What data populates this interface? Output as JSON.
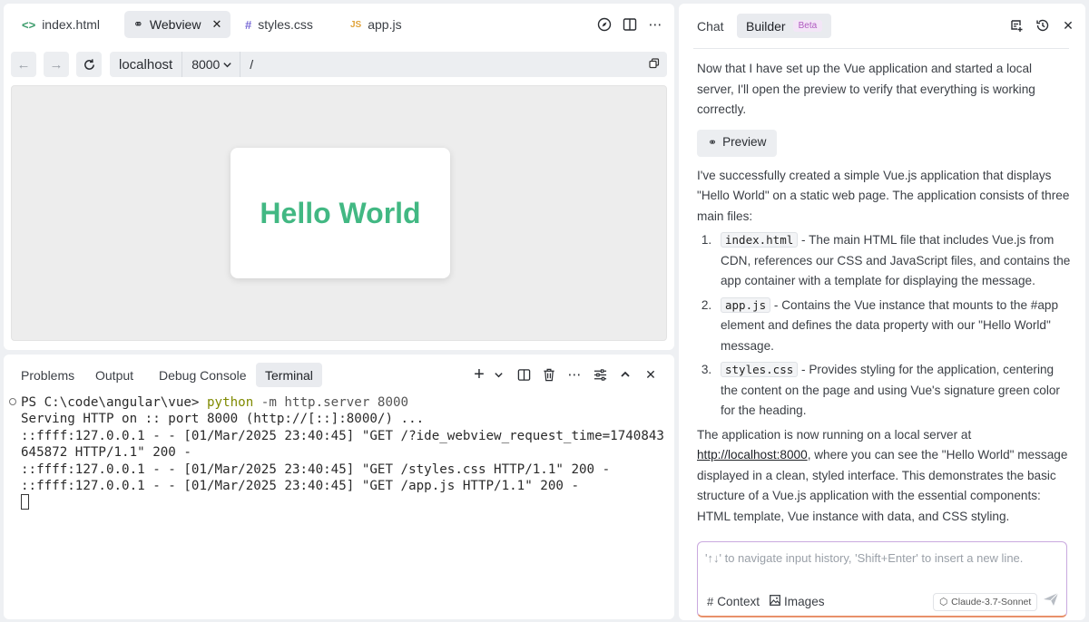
{
  "editor": {
    "tabs": [
      {
        "icon": "<>",
        "label": "index.html"
      },
      {
        "icon": "⚭",
        "label": "Webview",
        "close": "✕"
      },
      {
        "icon": "#",
        "label": "styles.css"
      },
      {
        "icon": "JS",
        "label": "app.js"
      }
    ],
    "toolbar_icons": [
      "compass-icon",
      "split-editor-icon",
      "more-icon"
    ]
  },
  "nav": {
    "host": "localhost",
    "port": "8000",
    "path": "/"
  },
  "webview": {
    "heading": "Hello World",
    "heading_color": "#42b883"
  },
  "panel": {
    "tabs": [
      "Problems",
      "Output",
      "Debug Console",
      "Terminal"
    ],
    "active_tab": "Terminal"
  },
  "terminal": {
    "prompt": "PS C:\\code\\angular\\vue> ",
    "command": "python",
    "args": " -m http.server 8000",
    "lines": [
      "Serving HTTP on :: port 8000 (http://[::]:8000/) ...",
      "::ffff:127.0.0.1 - - [01/Mar/2025 23:40:45] \"GET /?ide_webview_request_time=1740843",
      "645872 HTTP/1.1\" 200 -",
      "::ffff:127.0.0.1 - - [01/Mar/2025 23:40:45] \"GET /styles.css HTTP/1.1\" 200 -",
      "::ffff:127.0.0.1 - - [01/Mar/2025 23:40:45] \"GET /app.js HTTP/1.1\" 200 -"
    ]
  },
  "chat": {
    "tabs": {
      "chat": "Chat",
      "builder": "Builder",
      "badge": "Beta"
    },
    "intro": "Now that I have set up the Vue application and started a local server, I'll open the preview to verify that everything is working correctly.",
    "preview_label": "Preview",
    "summary": "I've successfully created a simple Vue.js application that displays \"Hello World\" on a static web page. The application consists of three main files:",
    "files": [
      {
        "name": "index.html",
        "desc": " - The main HTML file that includes Vue.js from CDN, references our CSS and JavaScript files, and contains the app container with a template for displaying the message."
      },
      {
        "name": "app.js",
        "desc": " - Contains the Vue instance that mounts to the #app element and defines the data property with our \"Hello World\" message."
      },
      {
        "name": "styles.css",
        "desc": " - Provides styling for the application, centering the content on the page and using Vue's signature green color for the heading."
      }
    ],
    "outro_before": "The application is now running on a local server at ",
    "outro_link": "http://localhost:8000",
    "outro_after": ", where you can see the \"Hello World\" message displayed in a clean, styled interface. This demonstrates the basic structure of a Vue.js application with the essential components: HTML template, Vue instance with data, and CSS styling."
  },
  "input": {
    "placeholder": "'↑↓' to navigate input history, 'Shift+Enter' to insert a new line.",
    "context_label": "Context",
    "images_label": "Images",
    "model": "Claude-3.7-Sonnet"
  }
}
